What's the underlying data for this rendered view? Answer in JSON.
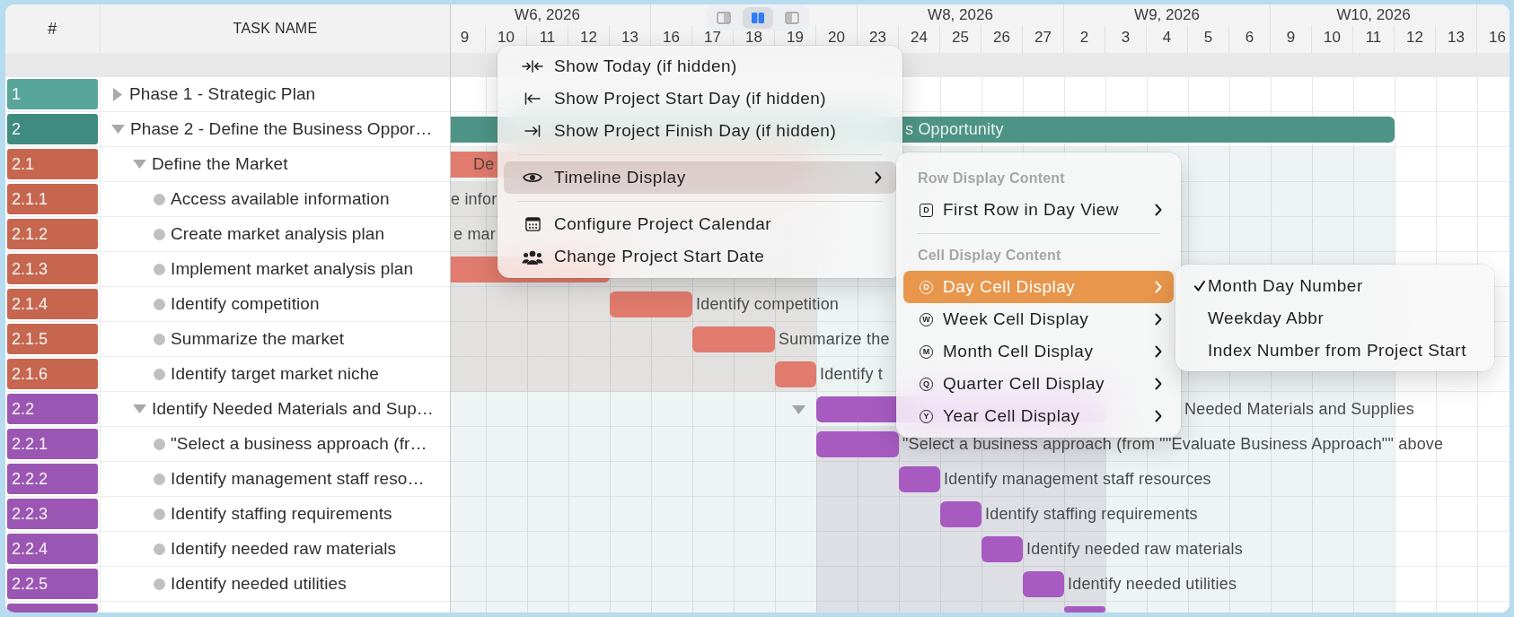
{
  "table": {
    "columns": [
      "#",
      "TASK NAME"
    ]
  },
  "timeline": {
    "weeks": [
      {
        "label": "W6, 2026",
        "days": [
          "9",
          "10",
          "11",
          "12",
          "13"
        ]
      },
      {
        "days": [
          "16",
          "17",
          "18",
          "19",
          "20"
        ]
      },
      {
        "label": "W8, 2026",
        "days": [
          "23",
          "24",
          "25",
          "26",
          "27"
        ]
      },
      {
        "label": "W9, 2026",
        "days": [
          "2",
          "3",
          "4",
          "5",
          "6"
        ]
      },
      {
        "label": "W10, 2026",
        "days": [
          "9",
          "10",
          "11",
          "12",
          "13"
        ]
      },
      {
        "days": [
          "16"
        ]
      }
    ],
    "view_switcher": [
      {
        "kind": "left-pane",
        "selected": false
      },
      {
        "kind": "split",
        "selected": true
      },
      {
        "kind": "right-pane",
        "selected": false
      }
    ]
  },
  "tasks": [
    {
      "number": "1",
      "name": "Phase 1 - Strategic Plan",
      "color": "#58a59a",
      "expanded": false
    },
    {
      "number": "2",
      "name": "Phase 2 - Define the Business Oppor…",
      "color": "#408b80",
      "expanded": true,
      "gantt": {
        "color": "#4e9486",
        "label": "s Opportunity"
      },
      "children": [
        {
          "number": "2.1",
          "name": "Define the Market",
          "color": "#c7664f",
          "expanded": true,
          "gantt": {
            "color": "#e07b6d",
            "label": "De"
          },
          "children": [
            {
              "number": "2.1.1",
              "name": "Access available information",
              "color": "#c7664f",
              "gantt": {
                "label": "e infor"
              }
            },
            {
              "number": "2.1.2",
              "name": "Create market analysis plan",
              "color": "#c7664f",
              "gantt": {
                "label": "e mar"
              }
            },
            {
              "number": "2.1.3",
              "name": "Implement market analysis plan",
              "color": "#c7664f",
              "gantt": {
                "color": "#e07b6d"
              }
            },
            {
              "number": "2.1.4",
              "name": "Identify competition",
              "color": "#c7664f",
              "gantt": {
                "color": "#e07b6d",
                "label": "Identify competition"
              }
            },
            {
              "number": "2.1.5",
              "name": "Summarize the market",
              "color": "#c7664f",
              "gantt": {
                "color": "#e07b6d",
                "label": "Summarize the"
              }
            },
            {
              "number": "2.1.6",
              "name": "Identify target market niche",
              "color": "#c7664f",
              "gantt": {
                "color": "#e07b6d",
                "label": "Identify t"
              }
            }
          ]
        },
        {
          "number": "2.2",
          "name": "Identify Needed Materials and Sup…",
          "color": "#9b56b4",
          "expanded": true,
          "gantt": {
            "color": "#a75bc1",
            "label": "Needed Materials and Supplies"
          },
          "children": [
            {
              "number": "2.2.1",
              "name": "\"Select a business approach (fr…",
              "color": "#9b56b4",
              "gantt": {
                "color": "#a75bc1",
                "label": "\"Select a business approach (from \"\"Evaluate Business Approach\"\" above"
              }
            },
            {
              "number": "2.2.2",
              "name": "Identify management staff reso…",
              "color": "#9b56b4",
              "gantt": {
                "color": "#a75bc1",
                "label": "Identify management staff resources"
              }
            },
            {
              "number": "2.2.3",
              "name": "Identify staffing requirements",
              "color": "#9b56b4",
              "gantt": {
                "color": "#a75bc1",
                "label": "Identify staffing requirements"
              }
            },
            {
              "number": "2.2.4",
              "name": "Identify needed raw materials",
              "color": "#9b56b4",
              "gantt": {
                "color": "#a75bc1",
                "label": "Identify needed raw materials"
              }
            },
            {
              "number": "2.2.5",
              "name": "Identify needed utilities",
              "color": "#9b56b4",
              "gantt": {
                "color": "#a75bc1",
                "label": "Identify needed utilities"
              }
            },
            {
              "color": "#9b56b4",
              "gantt": {
                "color": "#a75bc1"
              }
            }
          ]
        }
      ]
    }
  ],
  "menus": [
    {
      "focused": false,
      "items": [
        {
          "kind": "action",
          "label": "Show Today (if hidden)",
          "selected": false
        },
        {
          "kind": "action",
          "label": "Show Project Start Day (if hidden)",
          "selected": false
        },
        {
          "kind": "action",
          "label": "Show Project Finish Day (if hidden)",
          "selected": false
        },
        {
          "kind": "separator"
        },
        {
          "kind": "submenu",
          "label": "Timeline Display",
          "selected": true
        },
        {
          "kind": "separator"
        },
        {
          "kind": "action",
          "label": "Configure Project Calendar",
          "selected": false
        },
        {
          "kind": "action",
          "label": "Change Project Start Date",
          "selected": false
        }
      ]
    },
    {
      "focused": true,
      "items": [
        {
          "kind": "header",
          "label": "Row Display Content"
        },
        {
          "kind": "submenu",
          "icon_letter": "D",
          "label": "First Row in Day View",
          "selected": false
        },
        {
          "kind": "separator"
        },
        {
          "kind": "header",
          "label": "Cell Display Content"
        },
        {
          "kind": "submenu",
          "icon_letter": "D",
          "label": "Day Cell Display",
          "selected": true
        },
        {
          "kind": "submenu",
          "icon_letter": "W",
          "label": "Week Cell Display",
          "selected": false
        },
        {
          "kind": "submenu",
          "icon_letter": "M",
          "label": "Month Cell Display",
          "selected": false
        },
        {
          "kind": "submenu",
          "icon_letter": "Q",
          "label": "Quarter Cell Display",
          "selected": false
        },
        {
          "kind": "submenu",
          "icon_letter": "Y",
          "label": "Year Cell Display",
          "selected": false
        }
      ]
    },
    {
      "items": [
        {
          "kind": "option",
          "label": "Month Day Number",
          "checked": true,
          "selected": false
        },
        {
          "kind": "option",
          "label": "Weekday Abbr",
          "checked": false,
          "selected": false
        },
        {
          "kind": "option",
          "label": "Index Number from Project Start",
          "checked": false,
          "selected": false
        }
      ]
    }
  ]
}
